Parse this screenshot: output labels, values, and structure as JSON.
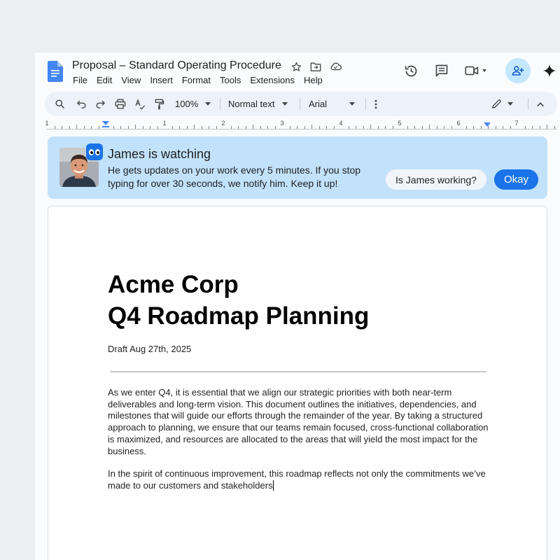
{
  "document": {
    "title": "Proposal – Standard Operating Procedure"
  },
  "menu": [
    "File",
    "Edit",
    "View",
    "Insert",
    "Format",
    "Tools",
    "Extensions",
    "Help"
  ],
  "toolbar": {
    "zoom": "100%",
    "style": "Normal text",
    "font": "Arial"
  },
  "ruler": {
    "numbers": [
      "1",
      "1",
      "2",
      "3",
      "4",
      "5",
      "6",
      "7"
    ]
  },
  "banner": {
    "title": "James is watching",
    "message": "He gets updates on your work every 5 minutes. If you stop typing for over 30 seconds, we notify him. Keep it up!",
    "question_button": "Is James working?",
    "ok_button": "Okay"
  },
  "content": {
    "heading_line1": "Acme Corp",
    "heading_line2": "Q4 Roadmap Planning",
    "draft_date": "Draft Aug 27th, 2025",
    "paragraph1": "As we enter Q4, it is essential that we align our strategic priorities with both near-term deliverables and long-term vision. This document outlines the initiatives, dependencies, and milestones that will guide our efforts through the remainder of the year. By taking a structured approach to planning, we ensure that our teams remain focused, cross-functional collaboration is maximized, and resources are allocated to the areas that will yield the most impact for the business.",
    "paragraph2": "In the spirit of continuous improvement, this roadmap reflects not only the commitments we’ve made to our customers and stakeholders"
  },
  "icons": {
    "doc_logo": "google-docs-icon",
    "star": "star-icon",
    "move": "folder-move-icon",
    "cloud": "cloud-saved-icon",
    "history": "history-icon",
    "comments": "comment-icon",
    "meet": "video-call-icon",
    "share": "add-person-icon",
    "gemini": "sparkle-icon"
  },
  "colors": {
    "accent": "#1a73e8",
    "banner_bg": "#c2e2fb",
    "toolbar_bg": "#edf2fa"
  }
}
